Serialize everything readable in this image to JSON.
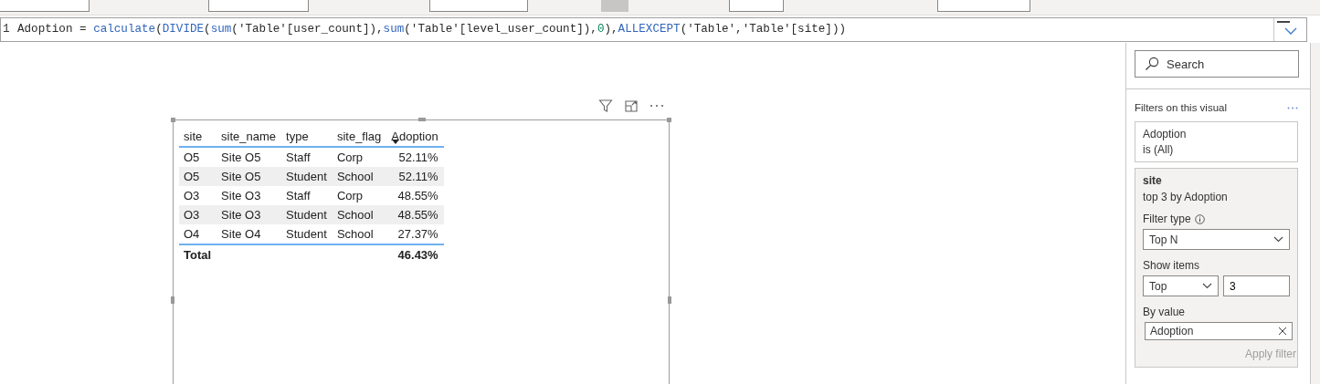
{
  "formula_bar": {
    "line_number": "1",
    "tokens": [
      {
        "kind": "plain",
        "text": "Adoption = "
      },
      {
        "kind": "function",
        "text": "calculate"
      },
      {
        "kind": "plain",
        "text": "("
      },
      {
        "kind": "function",
        "text": "DIVIDE"
      },
      {
        "kind": "plain",
        "text": "("
      },
      {
        "kind": "function",
        "text": "sum"
      },
      {
        "kind": "plain",
        "text": "('Table'[user_count]),"
      },
      {
        "kind": "function",
        "text": "sum"
      },
      {
        "kind": "plain",
        "text": "('Table'[level_user_count]),"
      },
      {
        "kind": "number",
        "text": "0"
      },
      {
        "kind": "plain",
        "text": "),"
      },
      {
        "kind": "function",
        "text": "ALLEXCEPT"
      },
      {
        "kind": "plain",
        "text": "('Table','Table'[site]))"
      }
    ]
  },
  "table": {
    "columns": [
      {
        "label": "site",
        "sorted": false
      },
      {
        "label": "site_name",
        "sorted": false
      },
      {
        "label": "type",
        "sorted": false
      },
      {
        "label": "site_flag",
        "sorted": false
      },
      {
        "label": "Adoption",
        "sorted": true
      }
    ],
    "rows": [
      [
        "O5",
        "Site O5",
        "Staff",
        "Corp",
        "52.11%"
      ],
      [
        "O5",
        "Site O5",
        "Student",
        "School",
        "52.11%"
      ],
      [
        "O3",
        "Site O3",
        "Staff",
        "Corp",
        "48.55%"
      ],
      [
        "O3",
        "Site O3",
        "Student",
        "School",
        "48.55%"
      ],
      [
        "O4",
        "Site O4",
        "Student",
        "School",
        "27.37%"
      ]
    ],
    "total": {
      "label": "Total",
      "value": "46.43%"
    }
  },
  "filters": {
    "search": {
      "placeholder": "Search"
    },
    "heading": "Filters on this visual",
    "cards": [
      {
        "field": "Adoption",
        "summary": "is (All)",
        "expanded": false
      },
      {
        "field": "site",
        "summary": "top 3 by Adoption",
        "expanded": true,
        "filter_type_label": "Filter type",
        "filter_type": "Top N",
        "show_items_label": "Show items",
        "direction": "Top",
        "count": "3",
        "by_value_label": "By value",
        "by_value": "Adoption",
        "apply": {
          "label": "Apply filter",
          "disabled": true
        }
      }
    ]
  }
}
